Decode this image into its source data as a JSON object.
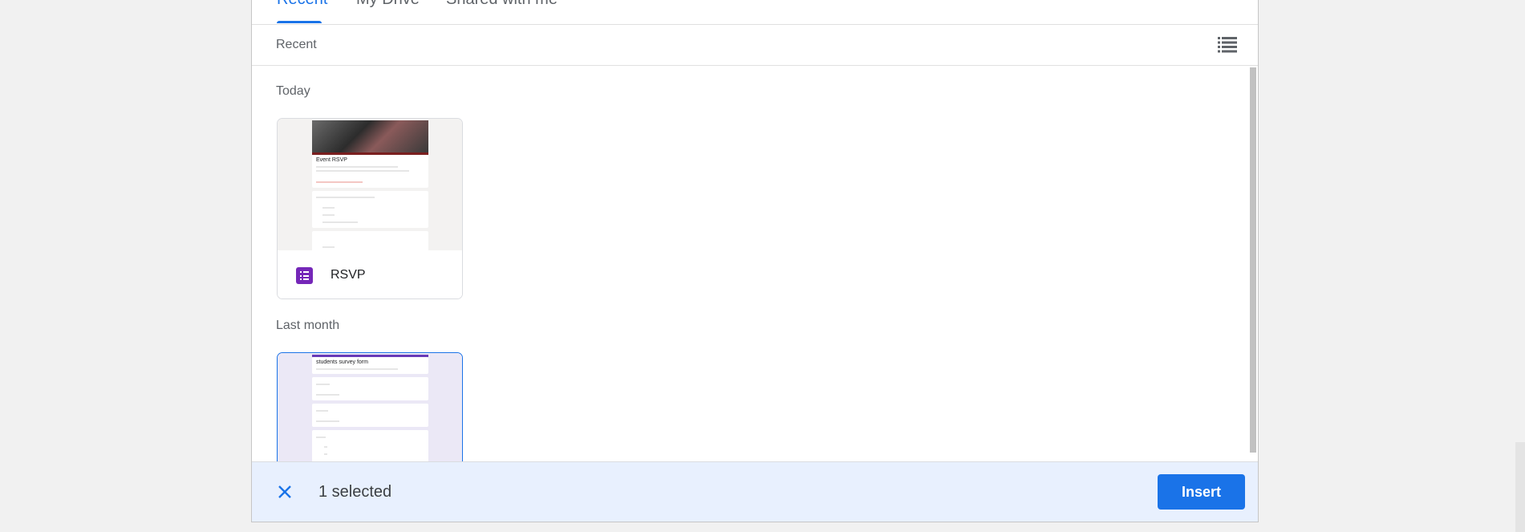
{
  "tabs": [
    {
      "label": "Recent",
      "active": true
    },
    {
      "label": "My Drive",
      "active": false
    },
    {
      "label": "Shared with me",
      "active": false
    }
  ],
  "breadcrumb": "Recent",
  "view_toggle_icon": "list-view-icon",
  "sections": [
    {
      "label": "Today",
      "files": [
        {
          "name": "RSVP",
          "type_icon": "google-forms-icon",
          "preview_title": "Event RSVP",
          "selected": false
        }
      ]
    },
    {
      "label": "Last month",
      "files": [
        {
          "name": "students survey form",
          "preview_title": "students survey form",
          "selected": true
        }
      ]
    }
  ],
  "footer": {
    "close_icon": "close-icon",
    "selected_text": "1 selected",
    "insert_label": "Insert"
  },
  "colors": {
    "accent": "#1a73e8",
    "forms_purple": "#7527b8",
    "footer_bg": "#e8f0fe",
    "selected_card_bg": "#ebe8f6"
  }
}
